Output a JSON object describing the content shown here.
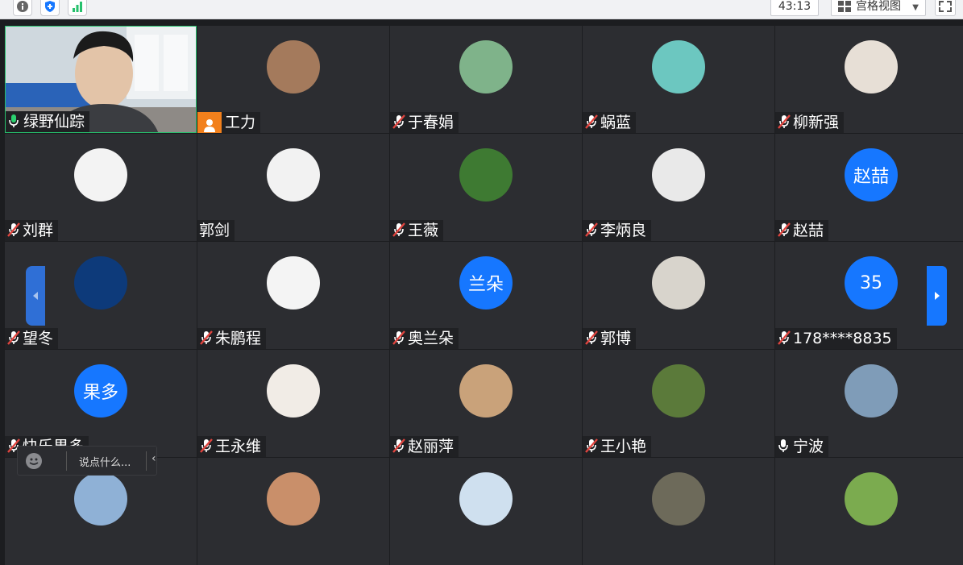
{
  "toolbar": {
    "timer": "43:13",
    "view_mode": "宫格视图",
    "icons": [
      "info-icon",
      "shield-icon",
      "signal-icon",
      "grid-view-icon",
      "fullscreen-icon"
    ]
  },
  "participants": [
    {
      "name": "绿野仙踪",
      "mic": "on",
      "avatar_text": "",
      "avatar_color": "#6a7a86"
    },
    {
      "name": "工力",
      "mic": "org",
      "avatar_text": "",
      "avatar_color": "#a47a5c"
    },
    {
      "name": "于春娟",
      "mic": "muted",
      "avatar_text": "",
      "avatar_color": "#7fb38a"
    },
    {
      "name": "蜗蓝",
      "mic": "muted",
      "avatar_text": "",
      "avatar_color": "#6cc7c0"
    },
    {
      "name": "柳新强",
      "mic": "muted",
      "avatar_text": "",
      "avatar_color": "#e7dfd6"
    },
    {
      "name": "刘群",
      "mic": "muted",
      "avatar_text": "",
      "avatar_color": "#f3f3f3"
    },
    {
      "name": "郭剑",
      "mic": "none",
      "avatar_text": "",
      "avatar_color": "#f2f2f2"
    },
    {
      "name": "王薇",
      "mic": "muted",
      "avatar_text": "",
      "avatar_color": "#3e7a32"
    },
    {
      "name": "李炳良",
      "mic": "muted",
      "avatar_text": "",
      "avatar_color": "#e9e9e9"
    },
    {
      "name": "赵喆",
      "mic": "muted",
      "avatar_text": "赵喆",
      "avatar_color": "#1677ff"
    },
    {
      "name": "望冬",
      "mic": "muted",
      "avatar_text": "",
      "avatar_color": "#0d3a7a"
    },
    {
      "name": "朱鹏程",
      "mic": "muted",
      "avatar_text": "",
      "avatar_color": "#f4f4f4"
    },
    {
      "name": "奥兰朵",
      "mic": "muted",
      "avatar_text": "兰朵",
      "avatar_color": "#1677ff"
    },
    {
      "name": "郭博",
      "mic": "muted",
      "avatar_text": "",
      "avatar_color": "#d8d4cc"
    },
    {
      "name": "178****8835",
      "mic": "muted",
      "avatar_text": "35",
      "avatar_color": "#1677ff"
    },
    {
      "name": "快乐果多",
      "mic": "muted",
      "avatar_text": "果多",
      "avatar_color": "#1677ff"
    },
    {
      "name": "王永维",
      "mic": "muted",
      "avatar_text": "",
      "avatar_color": "#f1ece6"
    },
    {
      "name": "赵丽萍",
      "mic": "muted",
      "avatar_text": "",
      "avatar_color": "#c9a27a"
    },
    {
      "name": "王小艳",
      "mic": "muted",
      "avatar_text": "",
      "avatar_color": "#5b7a3a"
    },
    {
      "name": "宁波",
      "mic": "on-white",
      "avatar_text": "",
      "avatar_color": "#7f9cb8"
    },
    {
      "name": "",
      "mic": "none",
      "avatar_text": "",
      "avatar_color": "#8fb1d6"
    },
    {
      "name": "",
      "mic": "none",
      "avatar_text": "",
      "avatar_color": "#c98f6a"
    },
    {
      "name": "",
      "mic": "none",
      "avatar_text": "",
      "avatar_color": "#cfe0ef"
    },
    {
      "name": "",
      "mic": "none",
      "avatar_text": "",
      "avatar_color": "#6d6a5a"
    },
    {
      "name": "",
      "mic": "none",
      "avatar_text": "",
      "avatar_color": "#7bab4f"
    }
  ],
  "chat": {
    "placeholder": "说点什么..."
  },
  "colors": {
    "accent": "#1677ff",
    "active_border": "#27c16d",
    "muted_red": "#e0443e",
    "tile_bg": "#2c2d31"
  }
}
